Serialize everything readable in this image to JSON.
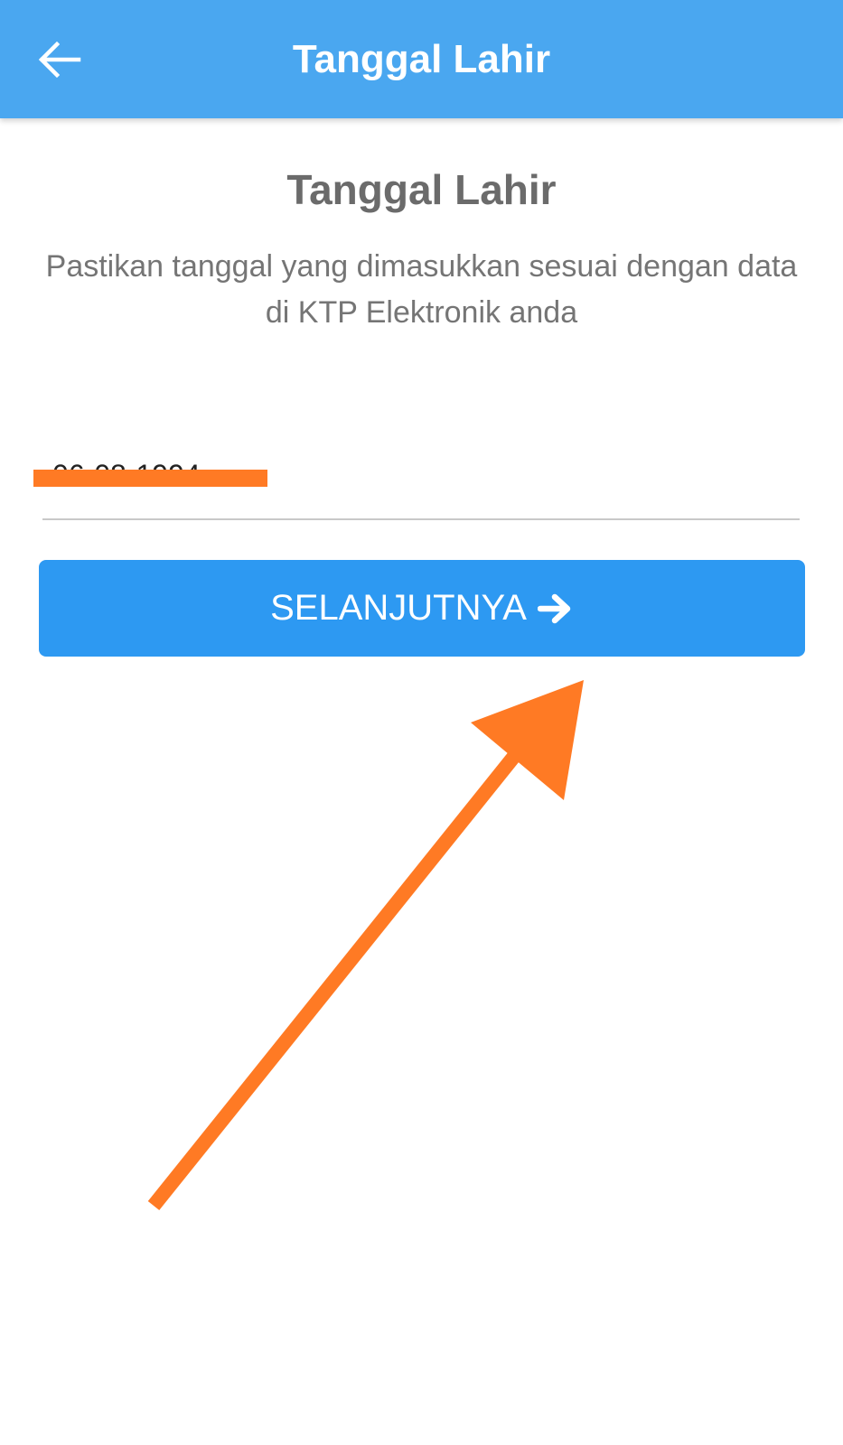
{
  "app_bar": {
    "title": "Tanggal Lahir",
    "back_icon": "arrow-left-icon",
    "background_color": "#4aa7f0"
  },
  "main": {
    "heading": "Tanggal Lahir",
    "description": "Pastikan tanggal yang dimasukkan sesuai dengan data di KTP Elektronik anda",
    "date_input": {
      "value": "06-08-1994"
    },
    "next_button": {
      "label": "SELANJUTNYA",
      "icon": "arrow-right-icon",
      "color": "#2d99f2"
    }
  },
  "annotation": {
    "color": "#ff7a24"
  }
}
